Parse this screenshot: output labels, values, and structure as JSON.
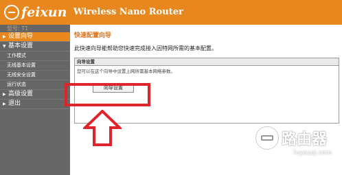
{
  "header": {
    "logo_text": "feixun",
    "product_name": "Wireless Nano Router"
  },
  "sidebar": {
    "model_label": "型号: T1",
    "items": [
      {
        "label": "设置向导",
        "active": true
      },
      {
        "label": "基本设置",
        "sub": [
          "工作模式",
          "无线基本设置",
          "无线安全设置",
          "运行状态"
        ]
      },
      {
        "label": "高级设置"
      },
      {
        "label": "退出"
      }
    ]
  },
  "main": {
    "title": "快速配置向导",
    "description": "此快速向导能帮助您快速完成接入因特网所需的基本配置。",
    "panel_title": "向导设置",
    "panel_text": "您可以在这个向导中设置上网所需基本网络参数。",
    "wizard_button": "向导设置"
  },
  "watermark": {
    "title": "路由器",
    "url": "luyouqi.com"
  },
  "colors": {
    "brand": "#e8871e",
    "sidebar": "#666666",
    "annotation": "#e0242b"
  }
}
